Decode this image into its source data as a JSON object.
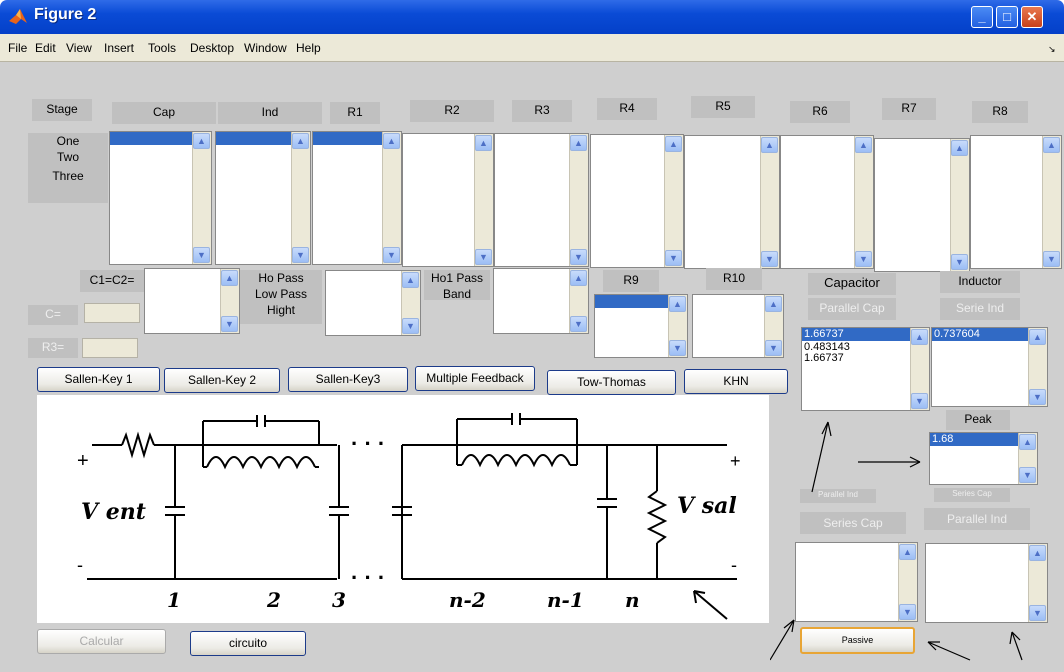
{
  "window": {
    "title": "Figure 2"
  },
  "menu": [
    "File",
    "Edit",
    "View",
    "Insert",
    "Tools",
    "Desktop",
    "Window",
    "Help"
  ],
  "stage": {
    "title": "Stage",
    "items": [
      "One",
      "Two",
      "Three"
    ]
  },
  "columns": {
    "cap": "Cap",
    "ind": "Ind",
    "r1": "R1",
    "r2": "R2",
    "r3": "R3",
    "r4": "R4",
    "r5": "R5",
    "r6": "R6",
    "r7": "R7",
    "r8": "R8"
  },
  "mid": {
    "c1c2": "C1=C2=",
    "ho_pass": [
      "Ho Pass",
      "Low Pass",
      "Hight"
    ],
    "ho1": [
      "Ho1 Pass",
      "Band"
    ],
    "r9": "R9",
    "r10": "R10",
    "c_eq": "C=",
    "r3_eq": "R3="
  },
  "buttons": {
    "sk1": "Sallen-Key 1",
    "sk2": "Sallen-Key 2",
    "sk3": "Sallen-Key3",
    "mf": "Multiple Feedback",
    "tt": "Tow-Thomas",
    "khn": "KHN",
    "calcular": "Calcular",
    "circuito": "circuito",
    "passive": "Passive"
  },
  "right": {
    "capacitor": "Capacitor",
    "inductor": "Inductor",
    "parallel_cap": "Parallel Cap",
    "serie_ind": "Serie Ind",
    "cap_values": [
      "1.66737",
      "0.483143",
      "1.66737"
    ],
    "ind_values": [
      "0.737604"
    ],
    "peak": "Peak",
    "peak_value": "1.68",
    "parallel_ind_small": "Parallel Ind",
    "series_cap_small": "Series Cap",
    "series_cap": "Series Cap",
    "parallel_ind": "Parallel Ind"
  },
  "circuit": {
    "v_in": "V ent",
    "v_out": "V sal",
    "plus": "+",
    "minus": "-",
    "dots": "· · ·",
    "nodes": [
      "1",
      "2",
      "3",
      "n-2",
      "n-1",
      "n"
    ]
  }
}
